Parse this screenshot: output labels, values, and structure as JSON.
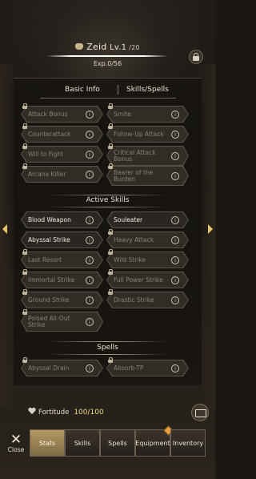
{
  "header": {
    "name": "Zeid",
    "level": "Lv.1",
    "level_max": "/20",
    "exp": "Exp.0/56"
  },
  "tabs": {
    "basic": "Basic Info",
    "skills": "Skills/Spells"
  },
  "passive_skills": [
    {
      "label": "Attack Bonus",
      "locked": true
    },
    {
      "label": "Smite",
      "locked": true
    },
    {
      "label": "Counterattack",
      "locked": true
    },
    {
      "label": "Follow-Up Attack",
      "locked": true
    },
    {
      "label": "Will to Fight",
      "locked": true
    },
    {
      "label": "Critical Attack Bonus",
      "locked": true
    },
    {
      "label": "Arcana Killer",
      "locked": true
    },
    {
      "label": "Bearer of the Burden",
      "locked": true
    }
  ],
  "active_title": "Active Skills",
  "active_skills": [
    {
      "label": "Blood Weapon",
      "locked": false
    },
    {
      "label": "Souleater",
      "locked": false
    },
    {
      "label": "Abyssal Strike",
      "locked": false
    },
    {
      "label": "Heavy Attack",
      "locked": true
    },
    {
      "label": "Last Resort",
      "locked": true
    },
    {
      "label": "Wild Strike",
      "locked": true
    },
    {
      "label": "Immortal Strike",
      "locked": true
    },
    {
      "label": "Full Power Strike",
      "locked": true
    },
    {
      "label": "Ground Strike",
      "locked": true
    },
    {
      "label": "Drastic Strike",
      "locked": true
    },
    {
      "label": "Poised All-Out Strike",
      "locked": true
    }
  ],
  "spells_title": "Spells",
  "spells": [
    {
      "label": "Abyssal Drain",
      "locked": true
    },
    {
      "label": "Absorb-TP",
      "locked": true
    }
  ],
  "fortitude": {
    "label": "Fortitude",
    "value": "100/100"
  },
  "bottom": {
    "close": "Close",
    "tabs": [
      "Stats",
      "Skills",
      "Spells",
      "Equipment",
      "Inventory"
    ],
    "selected": "Stats"
  },
  "info_glyph": "i",
  "colors": {
    "accent": "#b49a63",
    "arrow": "#e8c56a",
    "fortitude_value": "#f0d98a"
  }
}
